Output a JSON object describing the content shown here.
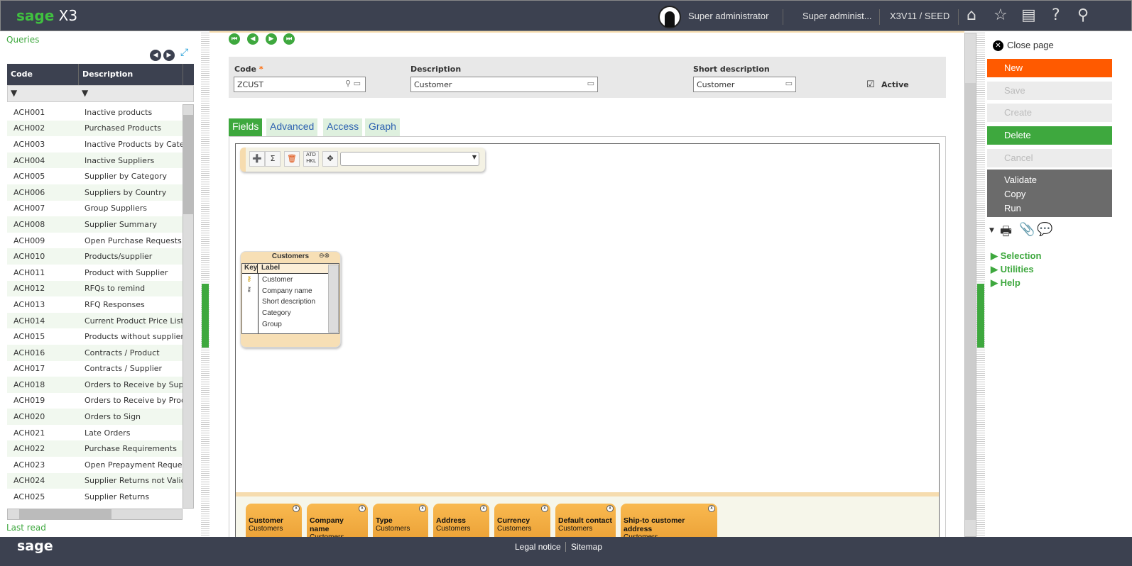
{
  "header": {
    "logo": "sage X3",
    "user": "Super administrator",
    "role": "Super administ...",
    "folder": "X3V11 / SEED",
    "icons": [
      "home-icon",
      "star-icon",
      "dashboard-icon",
      "help-icon",
      "search-icon"
    ]
  },
  "left": {
    "title": "Queries",
    "footer": "Last read",
    "columns": [
      "Code",
      "Description"
    ],
    "rows": [
      [
        "ACH001",
        "Inactive products"
      ],
      [
        "ACH002",
        "Purchased Products"
      ],
      [
        "ACH003",
        "Inactive Products by Category"
      ],
      [
        "ACH004",
        "Inactive Suppliers"
      ],
      [
        "ACH005",
        "Supplier by Category"
      ],
      [
        "ACH006",
        "Suppliers by Country"
      ],
      [
        "ACH007",
        "Group Suppliers"
      ],
      [
        "ACH008",
        "Supplier Summary"
      ],
      [
        "ACH009",
        "Open Purchase Requests"
      ],
      [
        "ACH010",
        "Products/supplier"
      ],
      [
        "ACH011",
        "Product with Supplier"
      ],
      [
        "ACH012",
        "RFQs to remind"
      ],
      [
        "ACH013",
        "RFQ Responses"
      ],
      [
        "ACH014",
        "Current Product Price List"
      ],
      [
        "ACH015",
        "Products without supplier"
      ],
      [
        "ACH016",
        "Contracts / Product"
      ],
      [
        "ACH017",
        "Contracts / Supplier"
      ],
      [
        "ACH018",
        "Orders to Receive by Supplier"
      ],
      [
        "ACH019",
        "Orders to Receive by Product"
      ],
      [
        "ACH020",
        "Orders to Sign"
      ],
      [
        "ACH021",
        "Late Orders"
      ],
      [
        "ACH022",
        "Purchase Requirements"
      ],
      [
        "ACH023",
        "Open Prepayment Requests"
      ],
      [
        "ACH024",
        "Supplier Returns not Validated"
      ],
      [
        "ACH025",
        "Supplier Returns"
      ]
    ]
  },
  "form": {
    "code_label": "Code",
    "code_value": "ZCUST",
    "desc_label": "Description",
    "desc_value": "Customer",
    "short_label": "Short description",
    "short_value": "Customer",
    "active_label": "Active",
    "active": true
  },
  "tabs": [
    "Fields",
    "Advanced",
    "Access",
    "Graph"
  ],
  "entity": {
    "title": "Customers",
    "col_key": "Key",
    "col_label": "Label",
    "fields": [
      "Customer",
      "Company name",
      "Short description",
      "Category",
      "Group"
    ]
  },
  "chips": [
    [
      "Customer",
      "Customers"
    ],
    [
      "Company name",
      "Customers"
    ],
    [
      "Type",
      "Customers"
    ],
    [
      "Address",
      "Customers"
    ],
    [
      "Currency",
      "Customers"
    ],
    [
      "Default contact",
      "Customers"
    ],
    [
      "Ship-to customer address",
      "Customers"
    ]
  ],
  "right": {
    "close": "Close page",
    "new": "New",
    "save": "Save",
    "create": "Create",
    "delete": "Delete",
    "cancel": "Cancel",
    "validate": "Validate",
    "copy": "Copy",
    "run": "Run",
    "selection": "Selection",
    "utilities": "Utilities",
    "help": "Help",
    "colors": {
      "new": "#ff5a00",
      "delete": "#3ea83e",
      "group": "#6b6b6b"
    }
  },
  "footer": {
    "logo": "sage",
    "legal": "Legal notice",
    "sitemap": "Sitemap"
  }
}
